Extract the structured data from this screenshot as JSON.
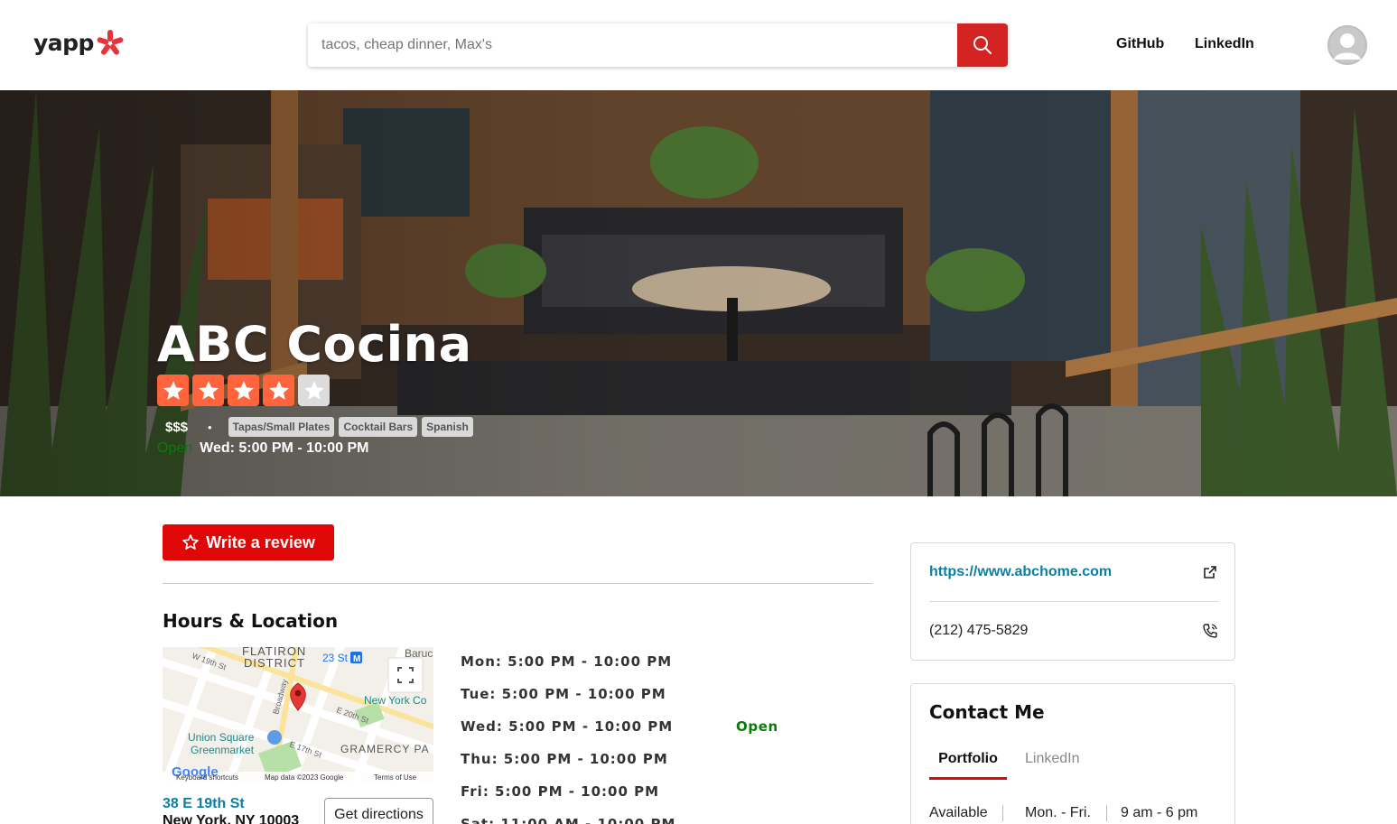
{
  "header": {
    "logo_text": "yapp",
    "search_placeholder": "tacos, cheap dinner, Max's",
    "nav": [
      "GitHub",
      "LinkedIn"
    ]
  },
  "business": {
    "name": "ABC Cocina",
    "rating": 4,
    "rating_max": 5,
    "price": "$$$",
    "separator": "•",
    "categories": [
      "Tapas/Small Plates",
      "Cocktail Bars",
      "Spanish"
    ],
    "status": "Open",
    "today_hours": "Wed: 5:00 PM - 10:00 PM"
  },
  "actions": {
    "write_review": "Write a review",
    "get_directions": "Get directions"
  },
  "location": {
    "section_title": "Hours & Location",
    "address_line1": "38 E 19th St",
    "address_line2": "New York, NY 10003",
    "map_labels": {
      "district": "FLATIRON",
      "district2": "DISTRICT",
      "subway": "23 St",
      "subway_line": "M",
      "nyc": "New York Co",
      "union1": "Union Square",
      "union2": "Greenmarket",
      "gramercy": "GRAMERCY PA",
      "street1": "W 19th St",
      "street2": "Broadway",
      "street3": "E 20th St",
      "street4": "E 17th St",
      "baruch": "Baruc",
      "google": "Google",
      "shortcuts": "Keyboard shortcuts",
      "mapdata": "Map data ©2023 Google",
      "terms": "Terms of Use"
    }
  },
  "hours": [
    {
      "day": "Mon: 5:00 PM - 10:00 PM"
    },
    {
      "day": "Tue: 5:00 PM - 10:00 PM"
    },
    {
      "day": "Wed: 5:00 PM - 10:00 PM"
    },
    {
      "day": "Thu: 5:00 PM - 10:00 PM"
    },
    {
      "day": "Fri: 5:00 PM - 10:00 PM"
    },
    {
      "day": "Sat: 11:00 AM - 10:00 PM"
    }
  ],
  "today_status": "Open",
  "sidebar": {
    "website": "https://www.abchome.com",
    "phone": "(212) 475-5829",
    "contact_title": "Contact Me",
    "tabs": [
      "Portfolio",
      "LinkedIn"
    ],
    "availability": [
      "Available",
      "Mon. - Fri.",
      "9 am - 6 pm"
    ]
  },
  "colors": {
    "brand_red": "#d32323",
    "star_orange": "#ff643d",
    "link_blue": "#0b7ea3",
    "open_green": "#0a7a0a"
  }
}
